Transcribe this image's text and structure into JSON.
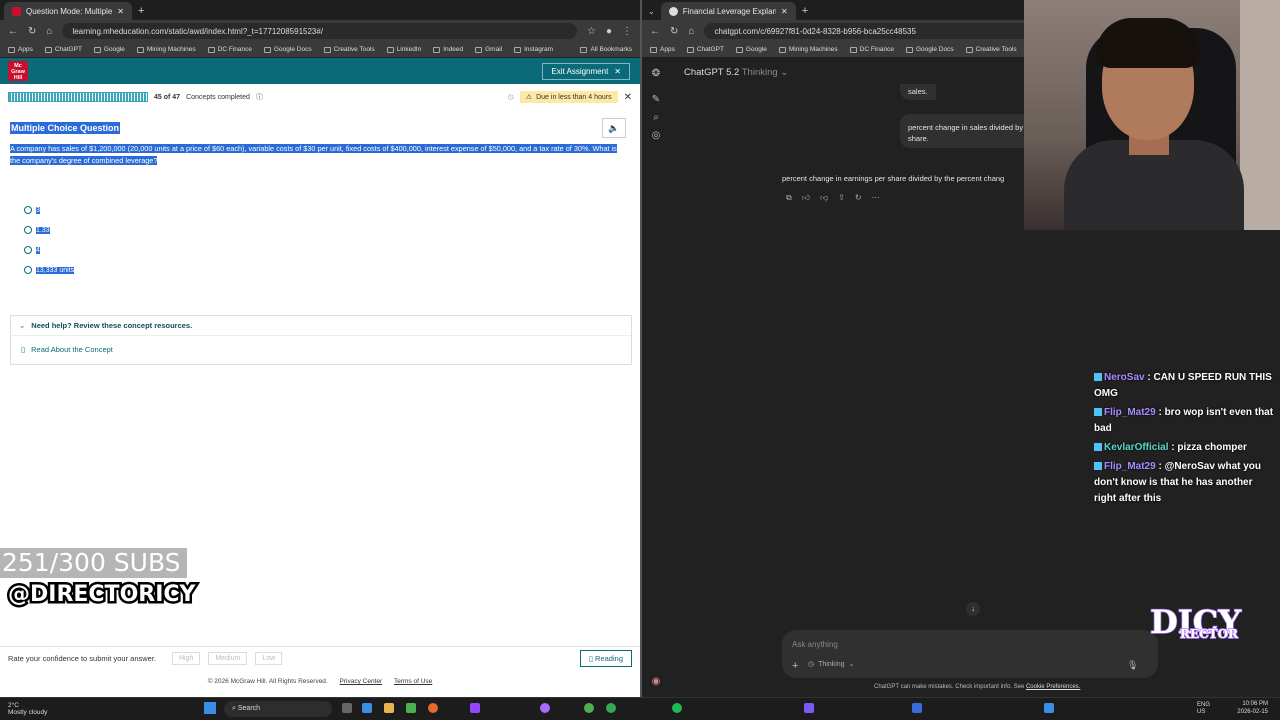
{
  "left_browser": {
    "tab_title": "Question Mode: Multiple Choic",
    "new_tab": "+",
    "url": "learning.mheducation.com/static/awd/index.html?_t=1771208591523#/",
    "bookmarks": [
      "Apps",
      "ChatGPT",
      "Google",
      "Mining Machines",
      "DC Finance",
      "Google Docs",
      "Creative Tools",
      "LinkedIn",
      "Indeed",
      "Gmail",
      "Instagram"
    ],
    "all_bookmarks": "All Bookmarks",
    "logo": "Mc Graw Hill",
    "exit_label": "Exit Assignment",
    "progress_text": "45 of 47",
    "progress_suffix": "Concepts completed",
    "progress_fraction": 0.957,
    "due_text": "Due in less than 4 hours",
    "question_heading": "Multiple Choice Question",
    "question_text": "A company has sales of $1,200,000 (20,000 units at a price of $60 each), variable costs of $30 per unit, fixed costs of $400,000, interest expense of $50,000, and a tax rate of 30%. What is the company's degree of combined leverage?",
    "options": [
      "3",
      "1.33",
      "4",
      "13,333 units"
    ],
    "help_heading": "Need help? Review these concept resources.",
    "help_link": "Read About the Concept",
    "confidence_prompt": "Rate your confidence to submit your answer.",
    "confidence_buttons": [
      "High",
      "Medium",
      "Low"
    ],
    "reading_label": "Reading",
    "footer_copy": "© 2026 McGraw Hill. All Rights Reserved.",
    "footer_links": [
      "Privacy Center",
      "Terms of Use"
    ]
  },
  "overlay": {
    "subs": "251/300 SUBS",
    "handle": "@DIRECTORICY"
  },
  "right_browser": {
    "tab_title": "Financial Leverage Explanation",
    "new_tab": "+",
    "url": "chatgpt.com/c/69927f81-0d24-8328-b956-bca25cc48535",
    "bookmarks": [
      "Apps",
      "ChatGPT",
      "Google",
      "Mining Machines",
      "DC Finance",
      "Google Docs",
      "Creative Tools"
    ],
    "model_name": "ChatGPT 5.2",
    "model_mode": "Thinking",
    "bubble_line1": "sales.",
    "bubble_line2": "percent change in sales divided by",
    "bubble_line3": "share.",
    "reply_text": "percent change in earnings per share divided by the percent chang",
    "input_placeholder": "Ask anything",
    "thinking_label": "Thinking",
    "disclaimer": "ChatGPT can make mistakes. Check important info. See",
    "disclaimer_link": "Cookie Preferences."
  },
  "chat": [
    {
      "user": "NeroSav",
      "text": ": CAN U SPEED RUN THIS OMG"
    },
    {
      "user": "Flip_Mat29",
      "text": ": bro wop isn't even that bad"
    },
    {
      "user": "KevlarOfficial",
      "text": ": pizza chomper"
    },
    {
      "user": "Flip_Mat29",
      "text": ": @NeroSav what you don't know is that he has another right after this"
    }
  ],
  "stream_logo": {
    "big": "DICY",
    "small": "RECTOR"
  },
  "taskbar": {
    "temp": "2°C",
    "weather": "Mostly cloudy",
    "search": "Search",
    "lang1": "ENG",
    "lang2": "US",
    "time": "10:06 PM",
    "date": "2026-02-15"
  },
  "colors": {
    "mh_teal": "#0b6a77",
    "selection": "#2b6bd8",
    "chatgpt_bg": "#212121"
  }
}
